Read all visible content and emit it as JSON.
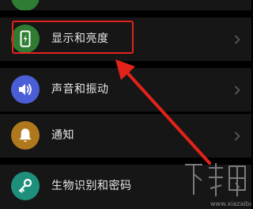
{
  "settings_list": {
    "items": [
      {
        "label": "显示和亮度",
        "icon": "display-brightness-icon",
        "icon_color": "#2e7d32"
      },
      {
        "label": "声音和振动",
        "icon": "speaker-icon",
        "icon_color": "#4a5fd6"
      },
      {
        "label": "通知",
        "icon": "bell-icon",
        "icon_color": "#b0781c"
      },
      {
        "label": "生物识别和密码",
        "icon": "key-icon",
        "icon_color": "#1e8f7a"
      }
    ],
    "chevron_icon": "chevron-right-icon"
  },
  "annotation": {
    "highlight_color": "#e3221a",
    "arrow_color": "#e3221a"
  },
  "watermark": {
    "text": "下载吧",
    "url": "www.xiazaiba.com"
  }
}
